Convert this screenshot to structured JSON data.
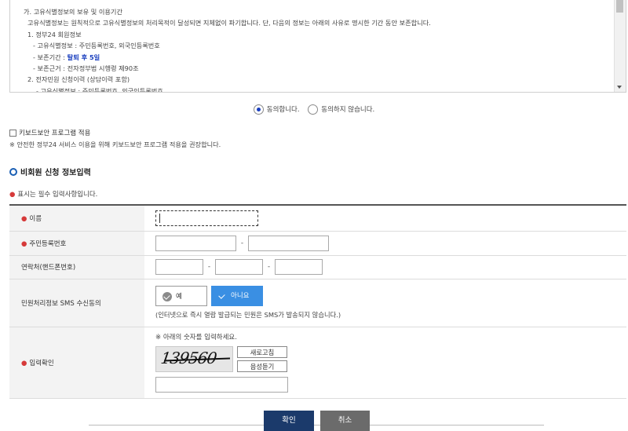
{
  "terms": {
    "lines": [
      "가. 고유식별정보의 보유 및 이용기간",
      "고유식별정보는 원칙적으로 고유식별정보의 처리목적이 달성되면 지체없이 파기합니다. 단, 다음의 정보는 아래의 사유로 명시한 기간 동안 보존합니다.",
      "1. 정부24 회원정보",
      "- 고유식별정보 : 주민등록번호, 외국인등록번호",
      "- 보존기간 :",
      "탈퇴 후 5일",
      "- 보존근거 : 전자정부법 시행령 제90조",
      "2. 전자민원 신청이력 (상담이력 포함)",
      "- 고유식별정보 : 주민등록번호, 외국인등록번호"
    ]
  },
  "agree": {
    "yes_label": "동의합니다.",
    "no_label": "동의하지 않습니다.",
    "selected": "yes"
  },
  "keyboard": {
    "checkbox_label": "키보드보안 프로그램 적용",
    "note": "※ 안전한 정부24 서비스 이용을 위해 키보드보안 프로그램 적용을 권장합니다."
  },
  "section": {
    "title": "비회원 신청 정보입력",
    "required_note": "표시는 필수 입력사항입니다.",
    "required_mark": "●"
  },
  "form": {
    "name_label": "이름",
    "rrn_label": "주민등록번호",
    "phone_label": "연락처(핸드폰번호)",
    "sms_label": "민원처리정보 SMS 수신동의",
    "sms_yes": "예",
    "sms_no": "아니요",
    "sms_note": "(인터넷으로 즉시 열람 발급되는 민원은 SMS가 발송되지 않습니다.)",
    "captcha_label": "입력확인",
    "captcha_hint": "※ 아래의 숫자를 입력하세요.",
    "captcha_text": "139560",
    "refresh_label": "새로고침",
    "audio_label": "음성듣기",
    "separator": "-"
  },
  "buttons": {
    "confirm": "확인",
    "cancel": "취소"
  }
}
